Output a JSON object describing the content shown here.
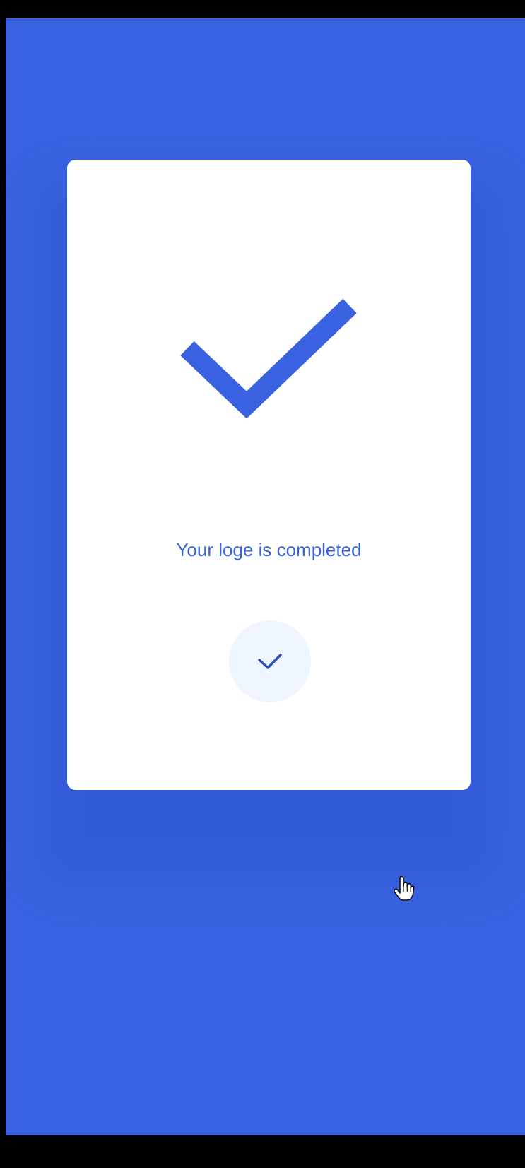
{
  "screen": {
    "background_color": "#3A62E0"
  },
  "card": {
    "background_color": "#FFFFFF",
    "hero_icon": "checkmark-icon",
    "message": "Your loge is completed",
    "accent_color": "#3A62E0"
  },
  "confirm_button": {
    "icon": "small-checkmark-icon",
    "background_color": "#EEF5FF"
  },
  "pointer": {
    "icon": "hand-pointer-cursor"
  }
}
